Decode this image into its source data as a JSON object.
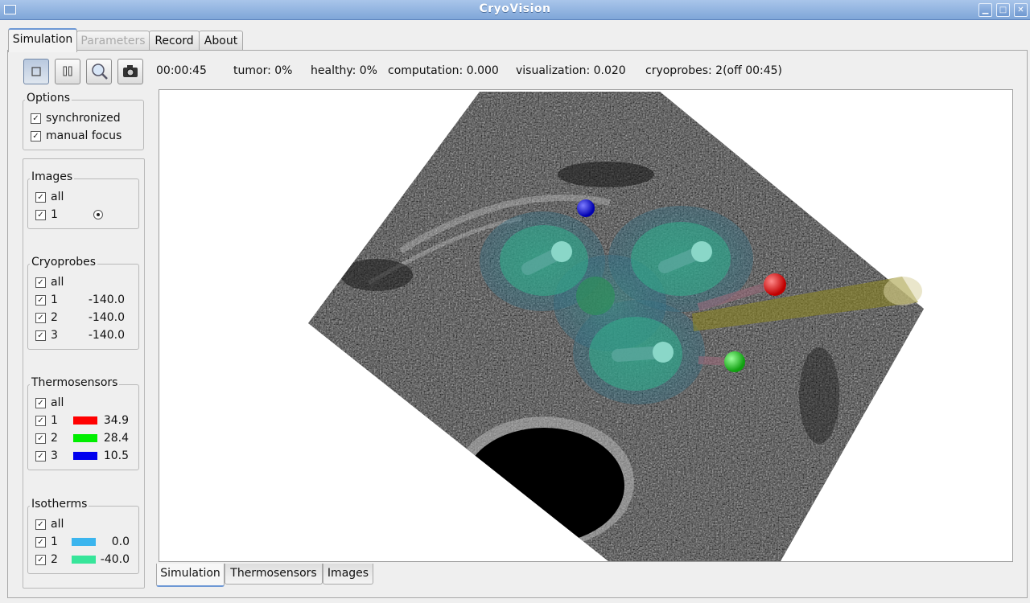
{
  "window": {
    "title": "CryoVision"
  },
  "tabs": [
    "Simulation",
    "Parameters",
    "Record",
    "About"
  ],
  "status": {
    "time": "00:00:45",
    "tumor": "tumor: 0%",
    "healthy": "healthy: 0%",
    "computation": "computation: 0.000",
    "visualization": "visualization: 0.020",
    "cryoprobes": "cryoprobes: 2(off 00:45)"
  },
  "toolbar": {
    "icons": [
      "stop-icon",
      "pause-icon",
      "zoom-icon",
      "camera-icon"
    ]
  },
  "options": {
    "title": "Options",
    "items": [
      {
        "label": "synchronized",
        "checked": true
      },
      {
        "label": "manual focus",
        "checked": true
      }
    ]
  },
  "images": {
    "title": "Images",
    "all": "all",
    "items": [
      {
        "label": "1",
        "selected": true
      }
    ]
  },
  "cryoprobes": {
    "title": "Cryoprobes",
    "all": "all",
    "items": [
      {
        "label": "1",
        "value": "-140.0"
      },
      {
        "label": "2",
        "value": "-140.0"
      },
      {
        "label": "3",
        "value": "-140.0"
      }
    ]
  },
  "thermosensors": {
    "title": "Thermosensors",
    "all": "all",
    "items": [
      {
        "label": "1",
        "color": "#ff0000",
        "value": "34.9"
      },
      {
        "label": "2",
        "color": "#00ee00",
        "value": "28.4"
      },
      {
        "label": "3",
        "color": "#0000ee",
        "value": "10.5"
      }
    ]
  },
  "isotherms": {
    "title": "Isotherms",
    "all": "all",
    "items": [
      {
        "label": "1",
        "color": "#3bb5ee",
        "value": "0.0"
      },
      {
        "label": "2",
        "color": "#37e59a",
        "value": "-40.0"
      }
    ]
  },
  "bottom_tabs": [
    "Simulation",
    "Thermosensors",
    "Images"
  ]
}
